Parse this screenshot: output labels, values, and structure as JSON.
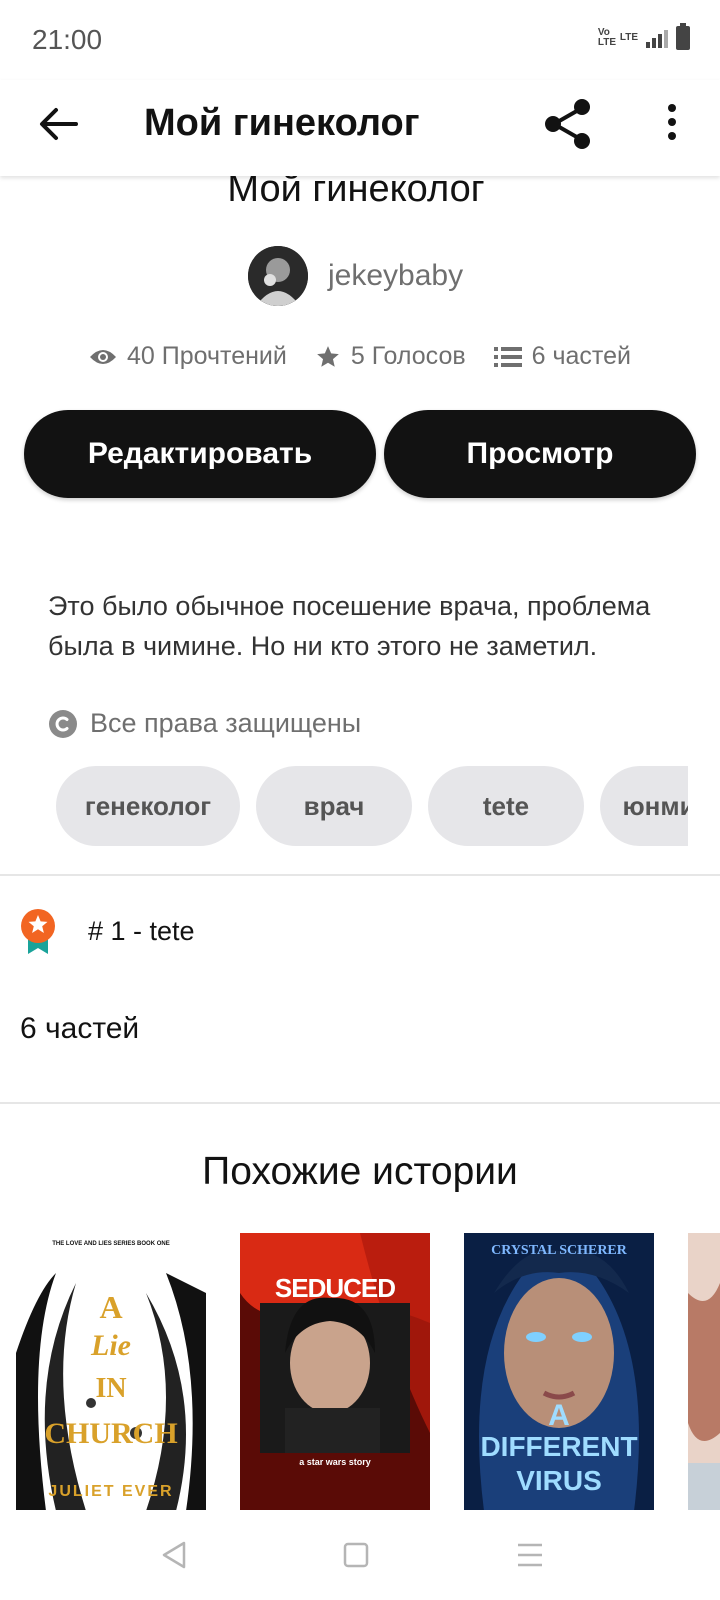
{
  "status_bar": {
    "time": "21:00",
    "network_1": "Vo LTE",
    "network_2": "LTE"
  },
  "app_bar": {
    "title": "Мой гинеколог",
    "back_icon": "arrow-left-icon",
    "share_icon": "share-icon",
    "more_icon": "more-vertical-icon"
  },
  "story": {
    "title": "Мой гинеколог",
    "author": "jekeybaby",
    "stats": {
      "reads": "40 Прочтений",
      "votes": "5 Голосов",
      "parts": "6 частей"
    },
    "edit_label": "Редактировать",
    "view_label": "Просмотр",
    "description": "Это было обычное посешение врача, проблема была в чимине. Но ни кто этого не заметил.",
    "copyright": "Все права защищены",
    "tags": [
      "генеколог",
      "врач",
      "tete",
      "юнмины"
    ],
    "rank": "# 1 - tete",
    "parts_count": "6 частей"
  },
  "similar": {
    "title": "Похожие истории",
    "covers": [
      {
        "top_text": "THE LOVE AND LIES SERIES BOOK ONE",
        "title_1": "A",
        "title_2": "Lie",
        "title_3": "IN",
        "title_4": "CHURCH",
        "author": "JULIET EVER"
      },
      {
        "title": "SEDUCED",
        "subtitle": "a star wars story"
      },
      {
        "author": "CRYSTAL SCHERER",
        "title_1": "A",
        "title_2": "DIFFERENT",
        "title_3": "VIRUS"
      },
      {
        "title": ""
      }
    ]
  },
  "colors": {
    "primary_button": "#121212",
    "tag_bg": "#e6e6e9",
    "badge": "#f26522",
    "ribbon": "#1aa39a"
  }
}
